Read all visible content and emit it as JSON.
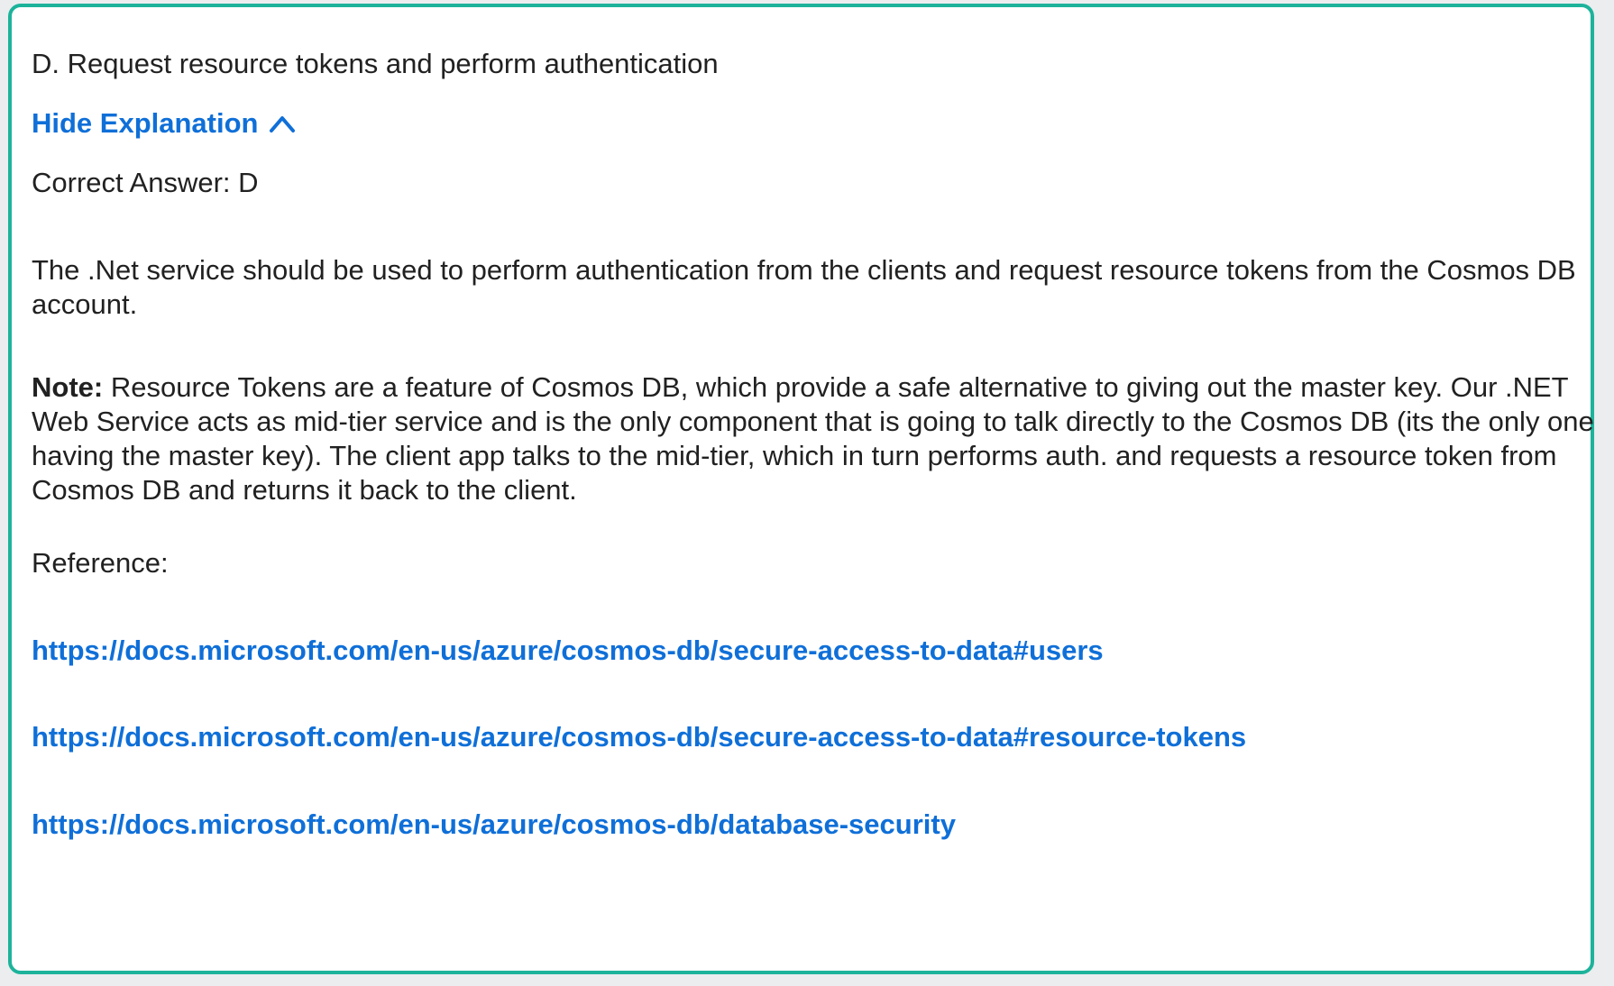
{
  "option": {
    "text": "D. Request resource tokens and perform authentication"
  },
  "explanation_toggle": {
    "label": "Hide Explanation",
    "icon": "chevron-up-icon"
  },
  "correct_answer": "Correct Answer: D",
  "explanation": "The .Net service should be used to perform authentication from the clients and request resource tokens from the Cosmos DB account.",
  "note": {
    "label": "Note:",
    "text": " Resource Tokens are a feature of Cosmos DB, which provide a safe alternative to giving out the master key. Our .NET Web Service acts as mid-tier service and is the only component that is going to talk directly to the Cosmos DB (its the only one having the master key). The client app talks to the mid-tier, which in turn performs auth. and requests a resource token from Cosmos DB and returns it back to the client."
  },
  "reference_label": "Reference:",
  "references": [
    "https://docs.microsoft.com/en-us/azure/cosmos-db/secure-access-to-data#users",
    "https://docs.microsoft.com/en-us/azure/cosmos-db/secure-access-to-data#resource-tokens",
    "https://docs.microsoft.com/en-us/azure/cosmos-db/database-security"
  ],
  "colors": {
    "border": "#1db39b",
    "link": "#0f6fd8",
    "text": "#212121"
  }
}
